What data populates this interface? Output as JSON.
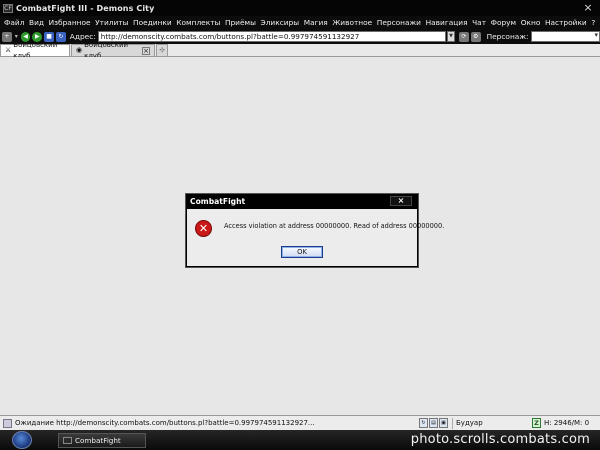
{
  "window": {
    "title": "CombatFight III - Demons City",
    "app_icon": "CF",
    "close_glyph": "×"
  },
  "menu": {
    "items": [
      "Файл",
      "Вид",
      "Избранное",
      "Утилиты",
      "Поединки",
      "Комплекты",
      "Приёмы",
      "Эликсиры",
      "Магия",
      "Животное",
      "Персонажи",
      "Навигация",
      "Чат",
      "Форум",
      "Окно",
      "Настройки",
      "?"
    ]
  },
  "addressbar": {
    "label": "Адрес:",
    "url": "http://demonscity.combats.com/buttons.pl?battle=0.997974591132927",
    "persona_label": "Персонаж:",
    "persona_value": ""
  },
  "tabs": [
    {
      "label": "Бойцовский клуб",
      "active": true
    },
    {
      "label": "Бойцовский клуб...",
      "active": false
    }
  ],
  "dialog": {
    "title": "CombatFight",
    "close_glyph": "×",
    "message": "Access violation at address 00000000. Read of address 00000000.",
    "ok_label": "OK",
    "icon_glyph": "✕"
  },
  "statusbar": {
    "text": "Ожидание http://demonscity.combats.com/buttons.pl?battle=0.997974591132927...",
    "room": "Будуар",
    "z_label": "Z",
    "counters": "Н: 2946/М: 0"
  },
  "taskbar": {
    "task_label": "CombatFight",
    "watermark": "photo.scrolls.combats.com"
  },
  "colors": {
    "chrome_dark": "#0c0c0c",
    "content_bg": "#e7e7e7",
    "error_red": "#c81818",
    "ok_border": "#1a3d8a"
  }
}
